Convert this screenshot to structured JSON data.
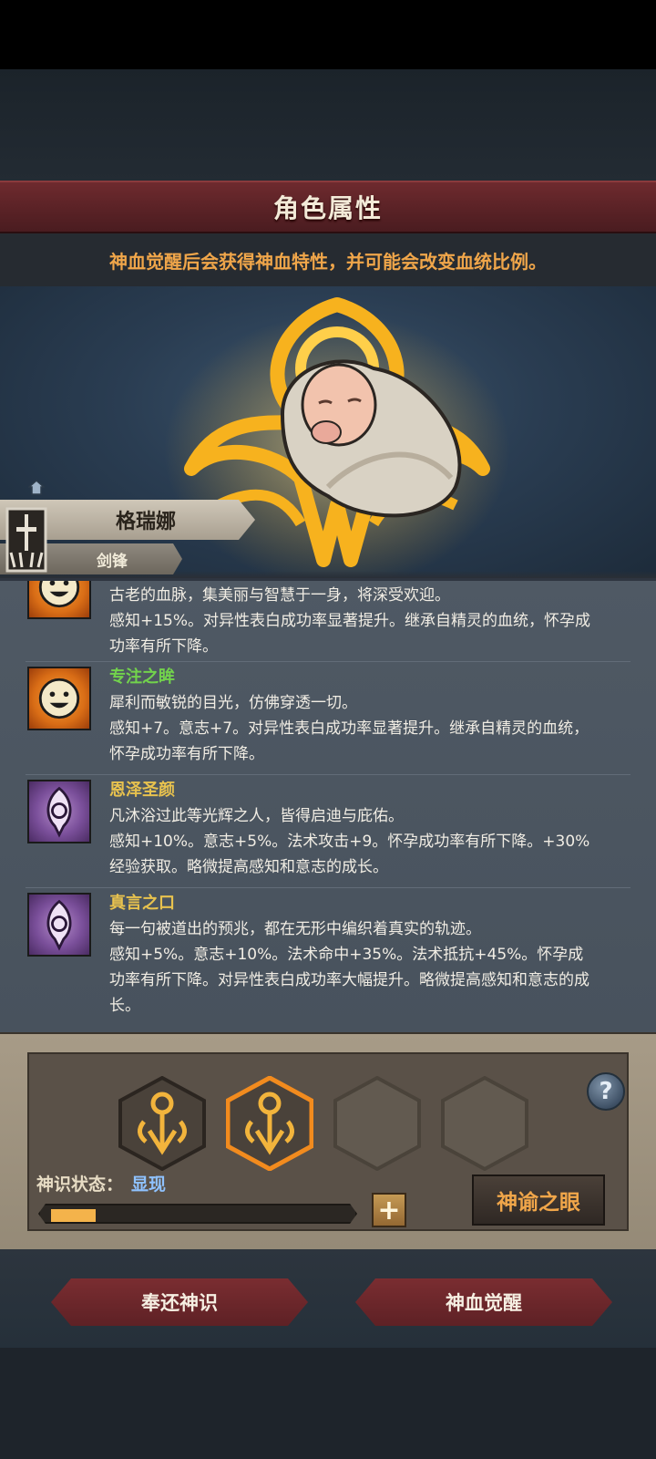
{
  "header": {
    "title": "角色属性",
    "hint": "神血觉醒后会获得神血特性，并可能会改变血统比例。"
  },
  "character": {
    "name": "格瑞娜",
    "class": "剑锋"
  },
  "traits": [
    {
      "title": "",
      "lines": [
        "古老的血脉，集美丽与智慧于一身，将深受欢迎。",
        "感知+15%。对异性表白成功率显著提升。继承自精灵的血统，怀孕成",
        "功率有所下降。"
      ]
    },
    {
      "title": "专注之眸",
      "lines": [
        "犀利而敏锐的目光，仿佛穿透一切。",
        "感知+7。意志+7。对异性表白成功率显著提升。继承自精灵的血统，",
        "怀孕成功率有所下降。"
      ]
    },
    {
      "title": "恩泽圣颜",
      "lines": [
        "凡沐浴过此等光辉之人，皆得启迪与庇佑。",
        "感知+10%。意志+5%。法术攻击+9。怀孕成功率有所下降。+30%",
        "经验获取。略微提高感知和意志的成长。"
      ]
    },
    {
      "title": "真言之口",
      "lines": [
        "每一句被道出的预兆，都在无形中编织着真实的轨迹。",
        "感知+5%。意志+10%。法术命中+35%。法术抵抗+45%。怀孕成",
        "功率有所下降。对异性表白成功率大幅提升。略微提高感知和意志的成",
        "长。"
      ]
    }
  ],
  "divine": {
    "status_label": "神识状态：",
    "status_value": "显现",
    "progress": 0.15,
    "help": "?",
    "plus": "+",
    "oracle_button": "神谕之眼"
  },
  "actions": {
    "return_label": "奉还神识",
    "awaken_label": "神血觉醒"
  },
  "colors": {
    "accent_orange": "#f0a64a",
    "title_red": "#5a2226",
    "trait_green": "#72d24c",
    "trait_gold": "#e8c24e"
  }
}
